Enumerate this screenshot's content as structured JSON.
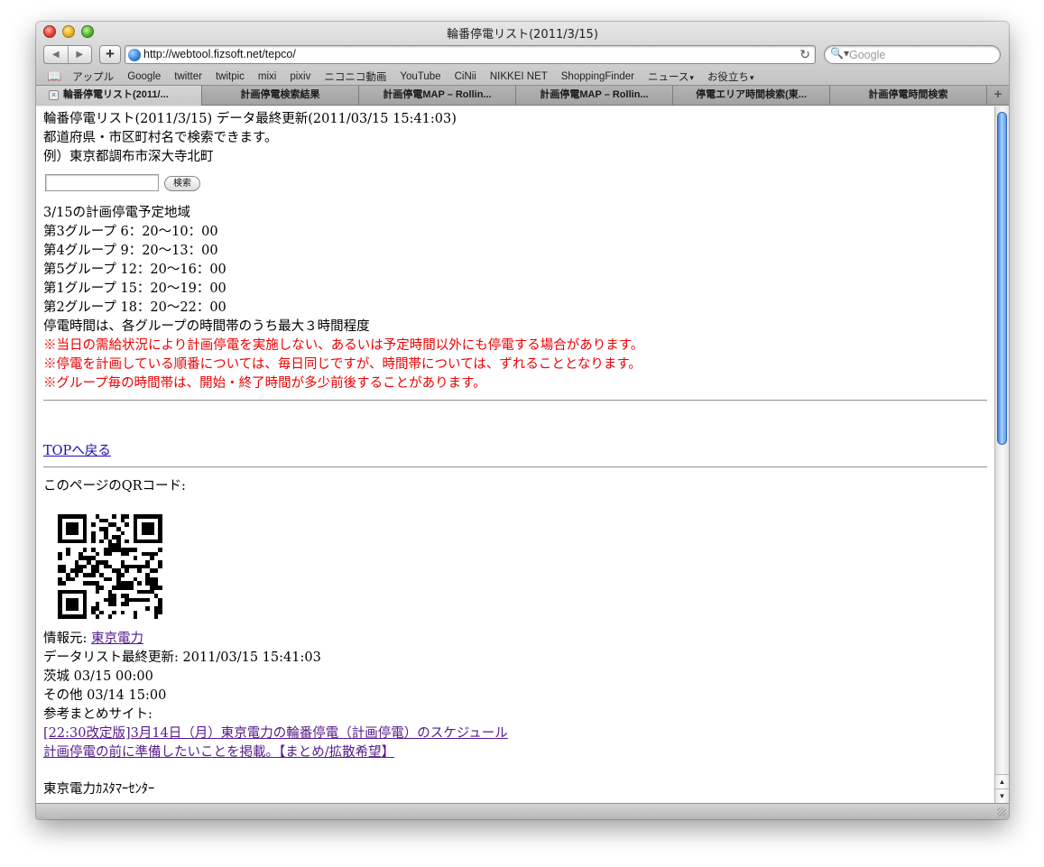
{
  "window": {
    "title": "輪番停電リスト(2011/3/15)"
  },
  "toolbar": {
    "back_label": "◀",
    "forward_label": "▶",
    "add_label": "+",
    "url": "http://webtool.fizsoft.net/tepco/",
    "reload_label": "↻",
    "search_icon": "magnifier-icon",
    "search_glass": "🔍▾",
    "search_placeholder": "Google"
  },
  "bookmarks": {
    "items": [
      "アップル",
      "Google",
      "twitter",
      "twitpic",
      "mixi",
      "pixiv",
      "ニコニコ動画",
      "YouTube",
      "CiNii",
      "NIKKEI NET",
      "ShoppingFinder"
    ],
    "menus": [
      "ニュース",
      "お役立ち"
    ]
  },
  "tabs": {
    "items": [
      "輪番停電リスト(2011/...",
      "計画停電検索結果",
      "計画停電MAP – Rollin...",
      "計画停電MAP – Rollin...",
      "停電エリア時間検索(東...",
      "計画停電時間検索"
    ],
    "close_label": "×",
    "add_label": "+"
  },
  "page": {
    "title_line": "輪番停電リスト(2011/3/15) データ最終更新(2011/03/15 15:41:03)",
    "intro": "都道府県・市区町村名で検索できます。",
    "example": "例）東京都調布市深大寺北町",
    "search_value": "",
    "search_button": "検索",
    "schedule_heading": "3/15の計画停電予定地域",
    "schedule": [
      "第3グループ 6：20〜10：00",
      "第4グループ 9：20〜13：00",
      "第5グループ 12：20〜16：00",
      "第1グループ 15：20〜19：00",
      "第2グループ 18：20〜22：00"
    ],
    "duration_note": "停電時間は、各グループの時間帯のうち最大３時間程度",
    "warnings": [
      "※当日の需給状況により計画停電を実施しない、あるいは予定時間以外にも停電する場合があります。",
      "※停電を計画している順番については、毎日同じですが、時間帯については、ずれることとなります。",
      "※グループ毎の時間帯は、開始・終了時間が多少前後することがあります。"
    ],
    "top_link": "TOPへ戻る",
    "qr_label": "このページのQRコード:",
    "source_label": "情報元: ",
    "source_link": "東京電力",
    "list_updated": "データリスト最終更新: 2011/03/15 15:41:03",
    "ibaraki": "茨城 03/15 00:00",
    "others": "その他 03/14 15:00",
    "ref_label": "参考まとめサイト:",
    "ref_link_1": "[22:30改定版]3月14日（月）東京電力の輪番停電（計画停電）のスケジュール",
    "ref_link_2": "計画停電の前に準備したいことを掲載。【まとめ/拡散希望】",
    "tepco_center": "東京電力ｶｽﾀﾏｰｾﾝﾀｰ"
  },
  "scrollbar": {
    "up_label": "▲",
    "down_label": "▼"
  }
}
